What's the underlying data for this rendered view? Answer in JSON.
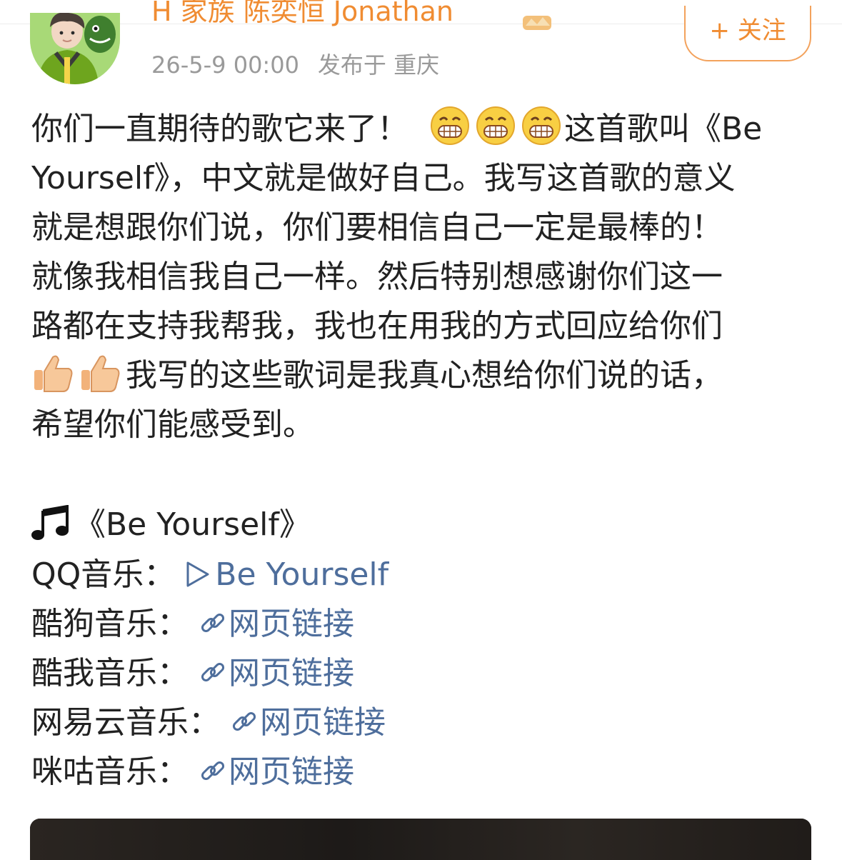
{
  "header": {
    "username": "H 家族 陈奕恒 Jonathan",
    "badge_icon": "member-badge-icon",
    "date": "26-5-9 00:00",
    "location": "发布于 重庆",
    "follow_label": "+ 关注",
    "accent_color": "#f08c32"
  },
  "post": {
    "segments": {
      "line1_text": "你们一直期待的歌它来了！",
      "line1_tail": "这首歌叫《Be",
      "emoji_grin": "grinning-face-emoji"
    },
    "lines": [
      "Yourself》，中文就是做好自己。我写这首歌的意义",
      "就是想跟你们说，你们要相信自己一定是最棒的！",
      "就像我相信我自己一样。然后特别想感谢你们这一",
      "路都在支持我帮我，我也在用我的方式回应给你们"
    ],
    "line6_text": "我写的这些歌词是我真心想给你们说的话，",
    "line7_text": "希望你们能感受到。",
    "thumb_emoji": "thumbs-up-emoji",
    "song_title": "《Be Yourself》",
    "note_icon": "music-note-icon"
  },
  "links": [
    {
      "label": "QQ音乐：",
      "link_text": "Be Yourself",
      "icon": "play-icon"
    },
    {
      "label": "酷狗音乐：",
      "link_text": "网页链接",
      "icon": "link-icon"
    },
    {
      "label": "酷我音乐：",
      "link_text": "网页链接",
      "icon": "link-icon"
    },
    {
      "label": "网易云音乐：",
      "link_text": "网页链接",
      "icon": "link-icon"
    },
    {
      "label": "咪咕音乐：",
      "link_text": "网页链接",
      "icon": "link-icon"
    }
  ],
  "colors": {
    "link": "#4e6e9c",
    "text": "#222222",
    "meta": "#9a9a9a"
  }
}
